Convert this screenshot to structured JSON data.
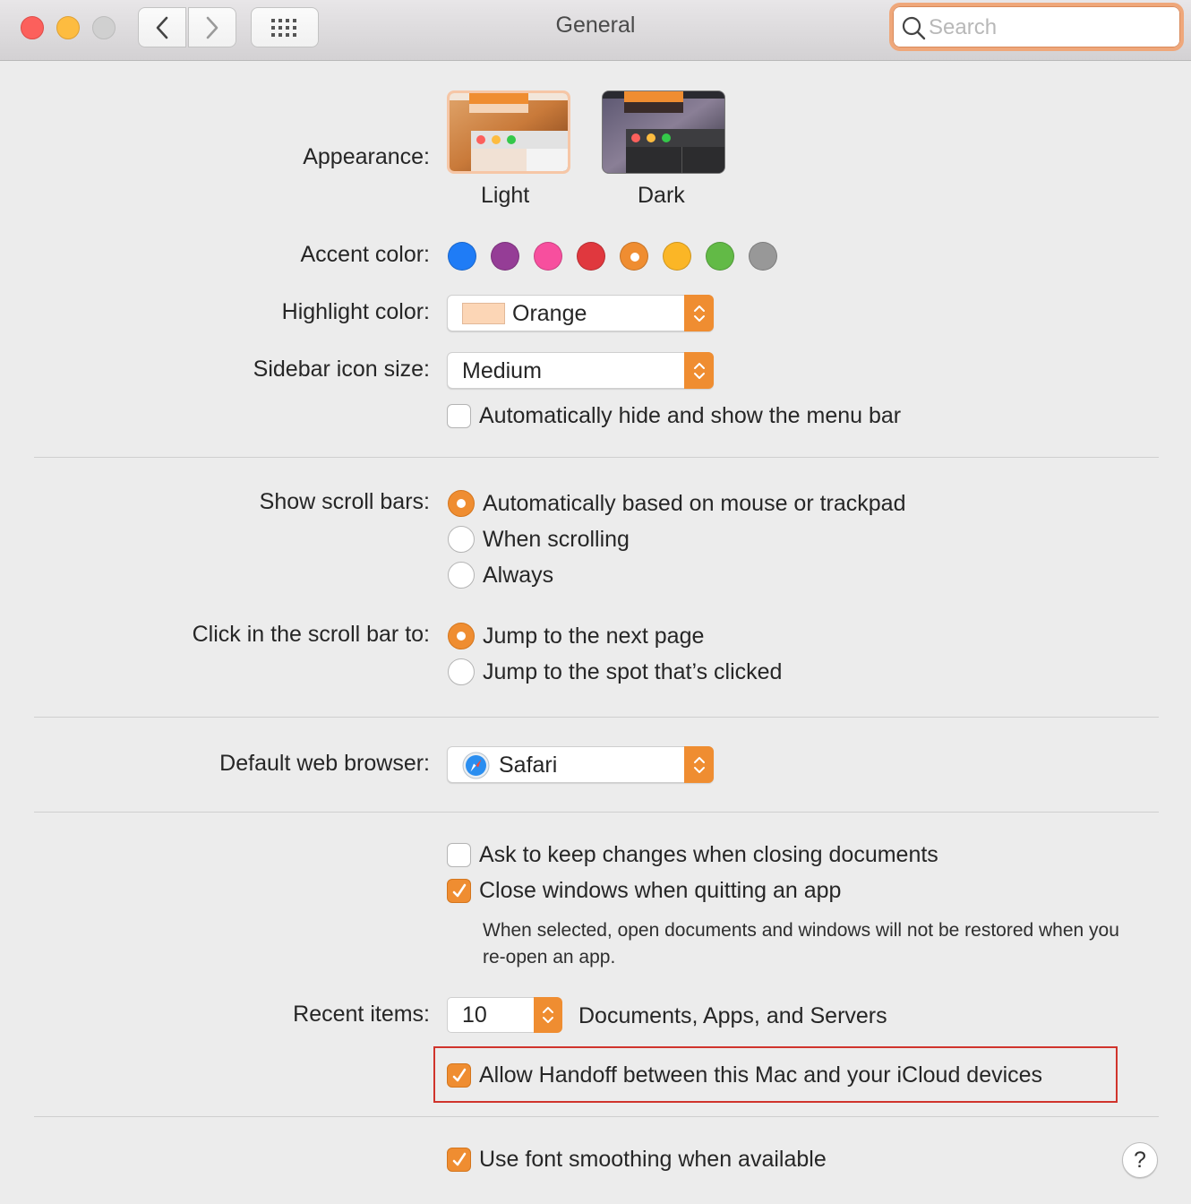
{
  "window": {
    "title": "General",
    "search_placeholder": "Search"
  },
  "appearance": {
    "label": "Appearance:",
    "options": [
      {
        "name": "Light",
        "selected": true
      },
      {
        "name": "Dark",
        "selected": false
      }
    ]
  },
  "accent": {
    "label": "Accent color:",
    "colors": [
      "#1f7cf6",
      "#953d96",
      "#f74f9e",
      "#e0383e",
      "#ef8d31",
      "#fbb626",
      "#62ba46",
      "#989898"
    ],
    "selected": "orange"
  },
  "highlight": {
    "label": "Highlight color:",
    "value": "Orange",
    "swatch": "#fcd6b6"
  },
  "sidebar_icon_size": {
    "label": "Sidebar icon size:",
    "value": "Medium"
  },
  "menu_bar": {
    "label": "Automatically hide and show the menu bar",
    "checked": false
  },
  "scroll_bars": {
    "label": "Show scroll bars:",
    "options": [
      {
        "label": "Automatically based on mouse or trackpad",
        "selected": true
      },
      {
        "label": "When scrolling",
        "selected": false
      },
      {
        "label": "Always",
        "selected": false
      }
    ]
  },
  "click_scroll": {
    "label": "Click in the scroll bar to:",
    "options": [
      {
        "label": "Jump to the next page",
        "selected": true
      },
      {
        "label": "Jump to the spot that’s clicked",
        "selected": false
      }
    ]
  },
  "browser": {
    "label": "Default web browser:",
    "value": "Safari"
  },
  "documents": {
    "ask_keep": {
      "label": "Ask to keep changes when closing documents",
      "checked": false
    },
    "close_windows": {
      "label": "Close windows when quitting an app",
      "checked": true
    },
    "note": "When selected, open documents and windows will not be restored when you re-open an app."
  },
  "recent": {
    "label": "Recent items:",
    "value": "10",
    "suffix": "Documents, Apps, and Servers"
  },
  "handoff": {
    "label": "Allow Handoff between this Mac and your iCloud devices",
    "checked": true
  },
  "font_smoothing": {
    "label": "Use font smoothing when available",
    "checked": true
  },
  "help": {
    "label": "?"
  },
  "colors": {
    "accent": "#ef8d31",
    "highlight_box": "#d0342c"
  }
}
